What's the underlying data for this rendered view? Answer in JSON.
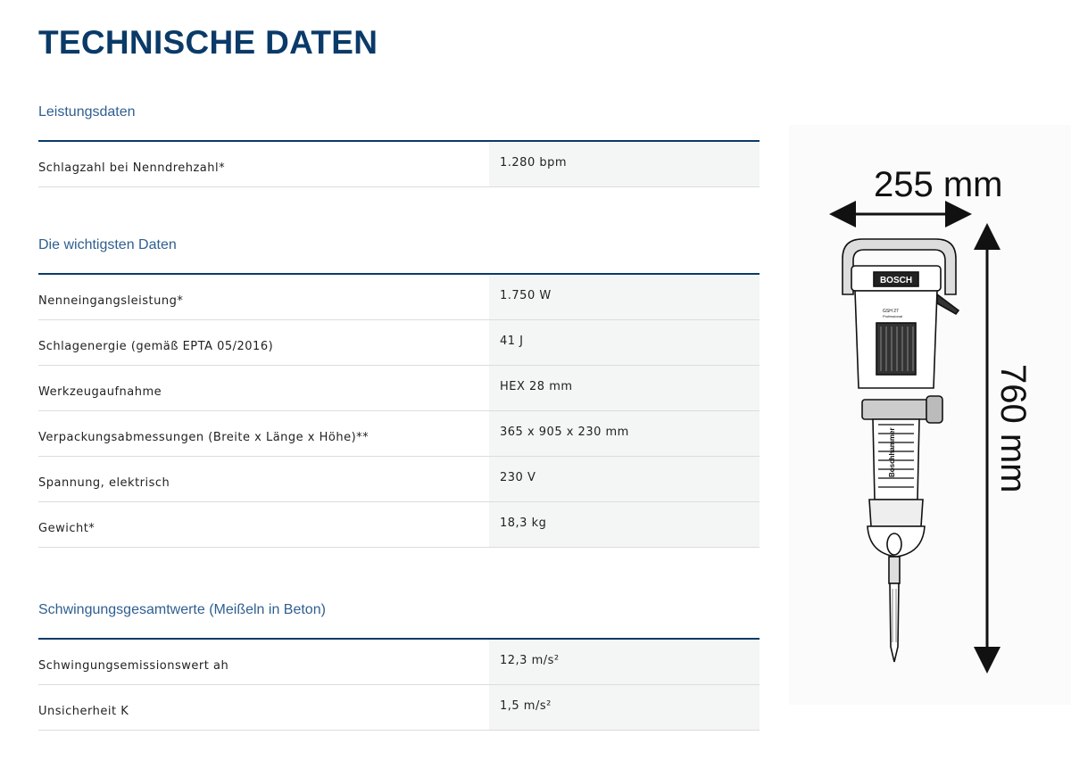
{
  "page": {
    "title": "TECHNISCHE DATEN"
  },
  "sections": [
    {
      "title": "Leistungsdaten",
      "rows": [
        {
          "label": "Schlagzahl bei Nenndrehzahl*",
          "value": "1.280 bpm"
        }
      ]
    },
    {
      "title": "Die wichtigsten Daten",
      "rows": [
        {
          "label": "Nenneingangsleistung*",
          "value": "1.750 W"
        },
        {
          "label": "Schlagenergie (gemäß EPTA 05/2016)",
          "value": "41 J"
        },
        {
          "label": "Werkzeugaufnahme",
          "value": "HEX 28 mm"
        },
        {
          "label": "Verpackungsabmessungen (Breite x Länge x Höhe)**",
          "value": "365 x 905 x 230 mm"
        },
        {
          "label": "Spannung, elektrisch",
          "value": "230 V"
        },
        {
          "label": "Gewicht*",
          "value": "18,3 kg"
        }
      ]
    },
    {
      "title": "Schwingungsgesamtwerte (Meißeln in Beton)",
      "rows": [
        {
          "label": "Schwingungsemissionswert ah",
          "value": "12,3 m/s²"
        },
        {
          "label": "Unsicherheit K",
          "value": "1,5 m/s²"
        }
      ]
    }
  ],
  "figure": {
    "width_label": "255 mm",
    "height_label": "760 mm",
    "brand_label": "BOSCH",
    "model_label": "GSH 27",
    "model_sub_label": "Professional",
    "handle_label": "Boschhammer"
  }
}
